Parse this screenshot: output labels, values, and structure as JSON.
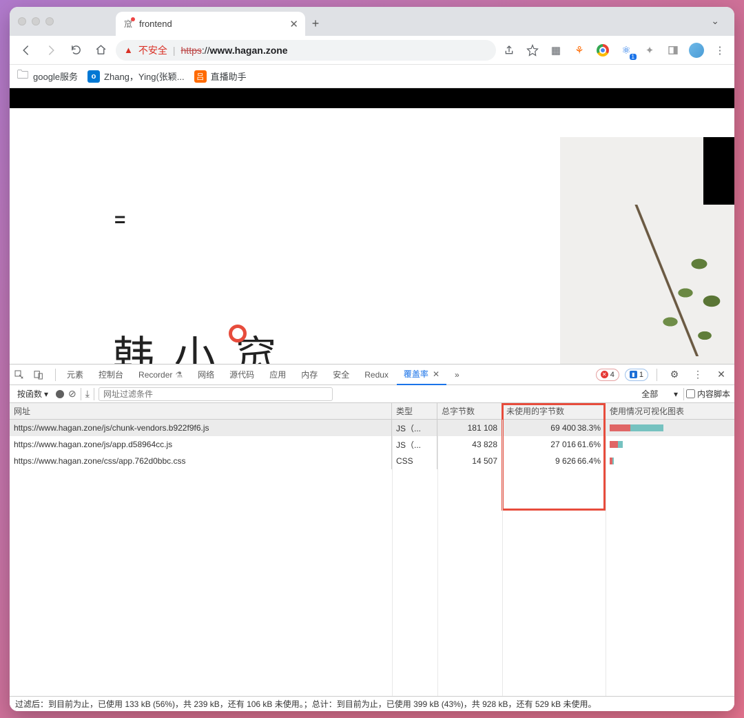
{
  "tab": {
    "title": "frontend"
  },
  "address": {
    "warn": "不安全",
    "scheme": "https",
    "rest": "://",
    "host": "www.hagan.zone"
  },
  "bookmarks": {
    "b1": "google服务",
    "b2": "Zhang，Ying(张颖...",
    "b3": "直播助手"
  },
  "page": {
    "hamburger": "☰",
    "title": "韩 小 窊"
  },
  "devtools": {
    "tabs": {
      "elements": "元素",
      "console": "控制台",
      "recorder": "Recorder",
      "network": "网络",
      "sources": "源代码",
      "application": "应用",
      "memory": "内存",
      "security": "安全",
      "redux": "Redux",
      "coverage": "覆盖率"
    },
    "errors": "4",
    "info": "1"
  },
  "coverage": {
    "perFn": "按函数",
    "filter_placeholder": "网址过滤条件",
    "scope": "全部",
    "content_script": "内容脚本",
    "headers": {
      "url": "网址",
      "type": "类型",
      "total": "总字节数",
      "unused": "未使用的字节数",
      "viz": "使用情况可视化图表"
    },
    "rows": [
      {
        "url": "https://www.hagan.zone/js/chunk-vendors.b922f9f6.js",
        "type": "JS（...",
        "total": "181 108",
        "unused": "69 400",
        "pct": "38.3%",
        "red": 30,
        "teal": 48
      },
      {
        "url": "https://www.hagan.zone/js/app.d58964cc.js",
        "type": "JS（...",
        "total": "43 828",
        "unused": "27 016",
        "pct": "61.6%",
        "red": 12,
        "teal": 7
      },
      {
        "url": "https://www.hagan.zone/css/app.762d0bbc.css",
        "type": "CSS",
        "total": "14 507",
        "unused": "9 626",
        "pct": "66.4%",
        "red": 4,
        "teal": 2
      }
    ]
  },
  "status": "过滤后：到目前为止，已使用 133 kB (56%)，共 239 kB，还有 106 kB 未使用。；总计：到目前为止，已使用 399 kB (43%)，共 928 kB，还有 529 kB 未使用。"
}
